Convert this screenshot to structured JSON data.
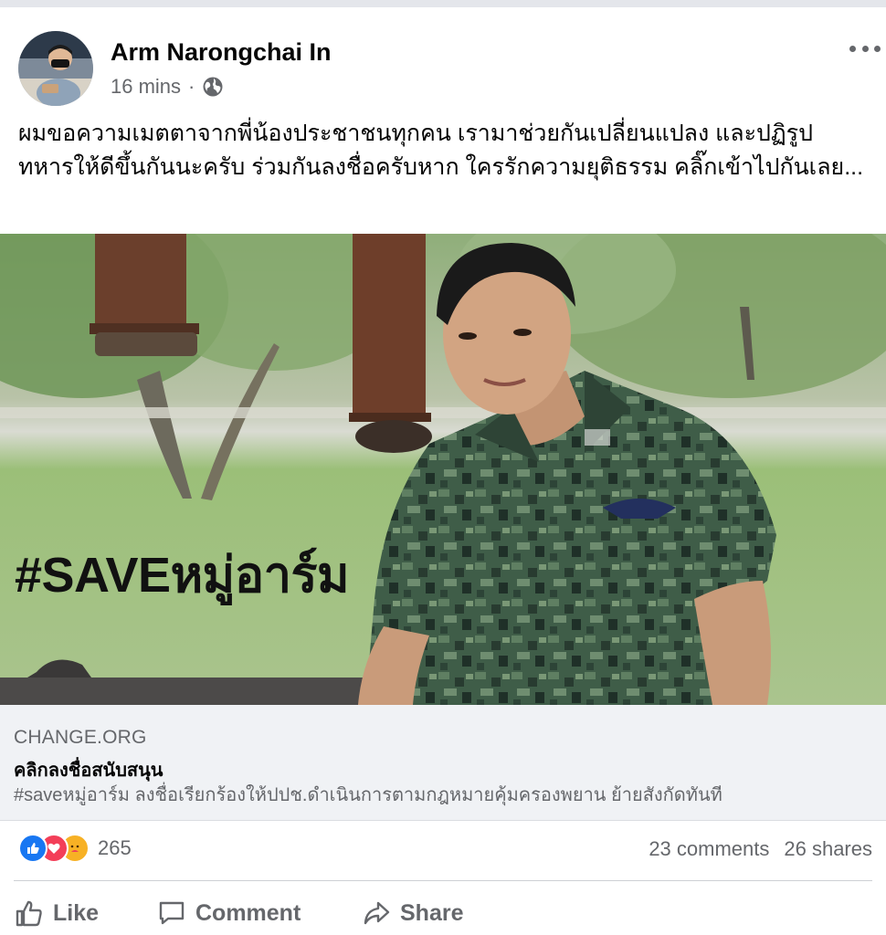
{
  "post": {
    "author": "Arm Narongchai In",
    "time": "16 mins",
    "separator": "·",
    "caption": "ผมขอความเมตตาจากพี่น้องประชาชนทุกคน เรามาช่วยกันเปลี่ยนแปลง และปฏิรูปทหารให้ดีขึ้นกันนะครับ ร่วมกันลงชื่อครับหาก ใครรักความยุติธรรม คลิ๊กเข้าไปกันเลย...",
    "image_text": "#SAVEหมู่อาร์ม"
  },
  "link_preview": {
    "domain": "CHANGE.ORG",
    "title": "คลิกลงชื่อสนับสนุน",
    "description": "#saveหมู่อาร์ม ลงชื่อเรียกร้องให้ปปช.ดำเนินการตามกฎหมายคุ้มครองพยาน ย้ายสังกัดทันที"
  },
  "stats": {
    "reaction_count": "265",
    "comments": "23 comments",
    "shares": "26 shares"
  },
  "actions": {
    "like": "Like",
    "comment": "Comment",
    "share": "Share"
  },
  "colors": {
    "like_blue": "#1877f2",
    "love_red": "#f33e58",
    "care_yellow": "#f7b125",
    "secondary_text": "#65676b"
  },
  "icons": {
    "privacy": "globe-icon",
    "more": "more-options-icon",
    "like": "thumbs-up-icon",
    "comment": "speech-bubble-icon",
    "share": "share-arrow-icon"
  }
}
